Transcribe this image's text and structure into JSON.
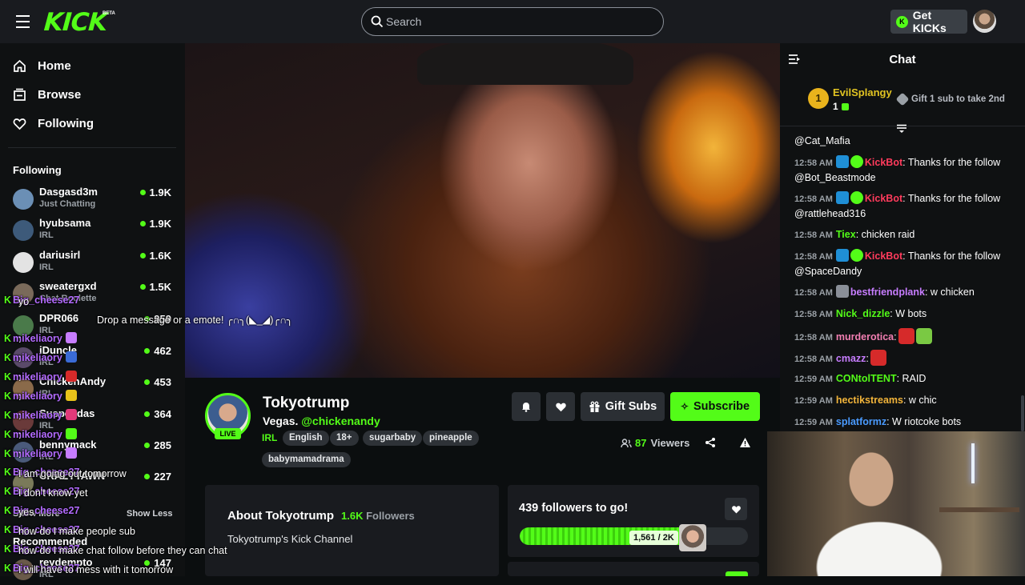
{
  "topbar": {
    "brand": "KICK",
    "brand_badge": "BETA",
    "search_placeholder": "Search",
    "get_kicks_label": "Get KICKs",
    "get_kicks_icon": "K",
    "accent": "#53fc18"
  },
  "sidebar": {
    "nav": [
      {
        "label": "Home",
        "icon": "home-icon"
      },
      {
        "label": "Browse",
        "icon": "browse-icon"
      },
      {
        "label": "Following",
        "icon": "heart-icon"
      }
    ],
    "following_title": "Following",
    "channels": [
      {
        "name": "Dasgasd3m",
        "category": "Just Chatting",
        "viewers": "1.9K",
        "color": "#6b8fb5"
      },
      {
        "name": "hyubsama",
        "category": "IRL",
        "viewers": "1.9K",
        "color": "#3d5a7a"
      },
      {
        "name": "dariusirl",
        "category": "IRL",
        "viewers": "1.6K",
        "color": "#e3e3e3"
      },
      {
        "name": "sweatergxd",
        "category": "Chat Roulette",
        "viewers": "1.5K",
        "color": "#7a6a5a"
      },
      {
        "name": "DPR066",
        "category": "IRL",
        "viewers": "959",
        "color": "#4a7a4a"
      },
      {
        "name": "iDuncle",
        "category": "IRL",
        "viewers": "462",
        "color": "#5a4a6a"
      },
      {
        "name": "ChickenAndy",
        "category": "IRL",
        "viewers": "453",
        "color": "#8a6a4a"
      },
      {
        "name": "Suspendas",
        "category": "IRL",
        "viewers": "364",
        "color": "#6a3a3a"
      },
      {
        "name": "bennymack",
        "category": "IRL",
        "viewers": "285",
        "color": "#4a5a7a"
      },
      {
        "name": "CRAZYTAWN",
        "category": "",
        "viewers": "227",
        "color": "#7a7a5a"
      }
    ],
    "show_more": "Show More",
    "show_less": "Show Less",
    "recommended_title": "Recommended",
    "recommended": [
      {
        "name": "reydempto",
        "category": "IRL",
        "viewers": "147",
        "color": "#6a5a4a"
      }
    ]
  },
  "overlay_chat": [
    {
      "user": "Big_cheese27",
      "text": "yo",
      "emote_color": ""
    },
    {
      "user": "",
      "text": "Drop a message or a emote!  ╭∩╮(◣_◢)╭∩╮",
      "emote_color": ""
    },
    {
      "user": "mikeliaory",
      "text": "",
      "emote_color": "#c77dff"
    },
    {
      "user": "mikeliaory",
      "text": "",
      "emote_color": "#3a6bd6"
    },
    {
      "user": "mikeliaory",
      "text": "",
      "emote_color": "#d62a2a"
    },
    {
      "user": "mikeliaory",
      "text": "",
      "emote_color": "#e8c21a"
    },
    {
      "user": "mikeliaory",
      "text": "",
      "emote_color": "#e23a7a"
    },
    {
      "user": "mikeliaory",
      "text": "",
      "emote_color": "#53fc18"
    },
    {
      "user": "mikeliaory",
      "text": "",
      "emote_color": "#c77dff"
    },
    {
      "user": "Big_cheese27",
      "text": "I am going out tomorrow",
      "emote_color": ""
    },
    {
      "user": "Big_cheese27",
      "text": "I don't know yet",
      "emote_color": ""
    },
    {
      "user": "Big_cheese27",
      "text": "yes",
      "emote_color": ""
    },
    {
      "user": "Big_cheese27",
      "text": "how do I make people sub",
      "emote_color": ""
    },
    {
      "user": "Big_cheese27",
      "text": "how do I make chat follow before they can chat",
      "emote_color": ""
    },
    {
      "user": "Big_cheese27",
      "text": "I will have to mess with it tomorrow",
      "emote_color": ""
    }
  ],
  "stream": {
    "name": "Tokyotrump",
    "title_prefix": "Vegas.",
    "title_mention": "@chickenandy",
    "live_label": "LIVE",
    "category": "IRL",
    "tags": [
      "English",
      "18+",
      "sugarbaby",
      "pineapple",
      "babymamadrama"
    ],
    "viewer_count": "87",
    "viewer_label": "Viewers",
    "gift_subs_label": "Gift Subs",
    "subscribe_label": "Subscribe"
  },
  "about": {
    "title": "About Tokyotrump",
    "followers_count": "1.6K",
    "followers_label": "Followers",
    "description": "Tokyotrump's Kick Channel"
  },
  "goal": {
    "title": "439 followers to go!",
    "progress_label": "1,561 / 2K",
    "current": 1561,
    "target": 2000
  },
  "chat": {
    "title": "Chat",
    "pinned": {
      "rank": "1",
      "user": "EvilSplangy",
      "count": "1",
      "gift_text": "Gift 1 sub to take 2nd"
    },
    "messages": [
      {
        "time": "",
        "user": "",
        "user_color": "#ffffff",
        "badges": [],
        "text": "@Cat_Mafia",
        "emotes": []
      },
      {
        "time": "12:58 AM",
        "user": "KickBot",
        "user_color": "#ff3b5c",
        "badges": [
          "bot",
          "ver"
        ],
        "text": ": Thanks for the follow @Bot_Beastmode",
        "emotes": []
      },
      {
        "time": "12:58 AM",
        "user": "KickBot",
        "user_color": "#ff3b5c",
        "badges": [
          "bot",
          "ver"
        ],
        "text": ": Thanks for the follow @rattlehead316",
        "emotes": []
      },
      {
        "time": "12:58 AM",
        "user": "Tiex",
        "user_color": "#53fc18",
        "badges": [],
        "text": ": chicken raid",
        "emotes": []
      },
      {
        "time": "12:58 AM",
        "user": "KickBot",
        "user_color": "#ff3b5c",
        "badges": [
          "bot",
          "ver"
        ],
        "text": ": Thanks for the follow @SpaceDandy",
        "emotes": []
      },
      {
        "time": "12:58 AM",
        "user": "bestfriendplank",
        "user_color": "#c77dff",
        "badges": [
          "gray"
        ],
        "text": ": w chicken",
        "emotes": []
      },
      {
        "time": "12:58 AM",
        "user": "Nick_dizzle",
        "user_color": "#53fc18",
        "badges": [],
        "text": ": W bots",
        "emotes": []
      },
      {
        "time": "12:58 AM",
        "user": "murderotica",
        "user_color": "#f27fb2",
        "badges": [],
        "text": ":",
        "emotes": [
          "#d62a2a",
          "#7ac943"
        ]
      },
      {
        "time": "12:58 AM",
        "user": "cmazz",
        "user_color": "#c77dff",
        "badges": [],
        "text": ":",
        "emotes": [
          "#d62a2a"
        ]
      },
      {
        "time": "12:59 AM",
        "user": "CONtolTENT",
        "user_color": "#53fc18",
        "badges": [],
        "text": ": RAID",
        "emotes": []
      },
      {
        "time": "12:59 AM",
        "user": "hectikstreams",
        "user_color": "#f2b43a",
        "badges": [],
        "text": ": w chic",
        "emotes": []
      },
      {
        "time": "12:59 AM",
        "user": "splatformz",
        "user_color": "#4a9bff",
        "badges": [],
        "text": ": W riotcoke bots",
        "emotes": []
      }
    ]
  }
}
